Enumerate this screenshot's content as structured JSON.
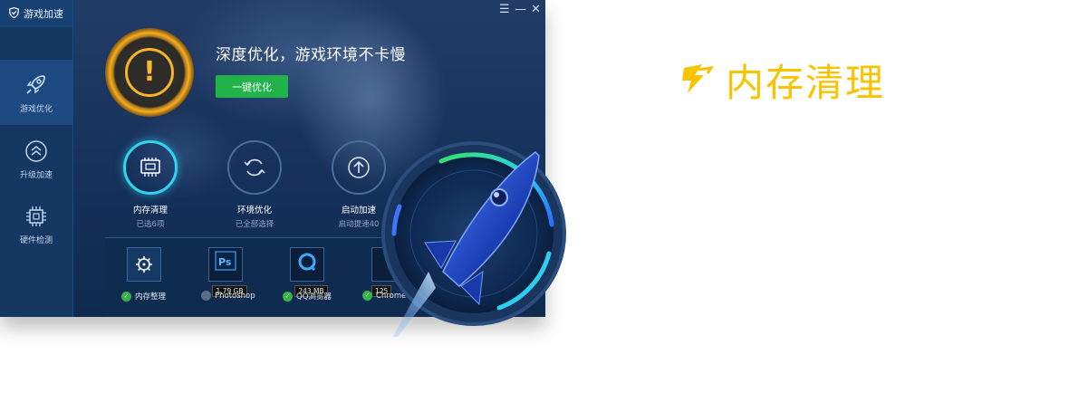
{
  "window": {
    "brand": "游戏加速",
    "controls": {
      "menu": "☰",
      "minimize": "—",
      "close": "✕"
    }
  },
  "sidebar": {
    "items": [
      {
        "label": "游戏优化",
        "icon": "rocket-icon"
      },
      {
        "label": "升级加速",
        "icon": "upgrade-chevron-icon"
      },
      {
        "label": "硬件检测",
        "icon": "chip-icon"
      }
    ]
  },
  "hero": {
    "title": "深度优化，游戏环境不卡慢",
    "button": "一键优化",
    "warning": "!"
  },
  "features": [
    {
      "name": "内存清理",
      "sub": "已选6项",
      "icon": "memory-icon"
    },
    {
      "name": "环境优化",
      "sub": "已全部选择",
      "icon": "refresh-icon"
    },
    {
      "name": "启动加速",
      "sub": "启动提速40",
      "icon": "upload-icon"
    }
  ],
  "processes": [
    {
      "label": "内存整理",
      "size": "",
      "checked": true,
      "icon": "gear-icon"
    },
    {
      "label": "Photoshop",
      "size": "1.79 GB",
      "checked": false,
      "icon": "photoshop-icon"
    },
    {
      "label": "QQ浏览器",
      "size": "243 MB",
      "checked": true,
      "icon": "qq-browser-icon"
    },
    {
      "label": "Chrome",
      "size": "125",
      "checked": true,
      "icon": "chrome-icon"
    }
  ],
  "heading": {
    "text": "内存清理",
    "color": "#f9c300"
  },
  "colors": {
    "accent_green": "#21b34a",
    "accent_cyan": "#2fd4f0",
    "warning": "#f5b42a"
  }
}
